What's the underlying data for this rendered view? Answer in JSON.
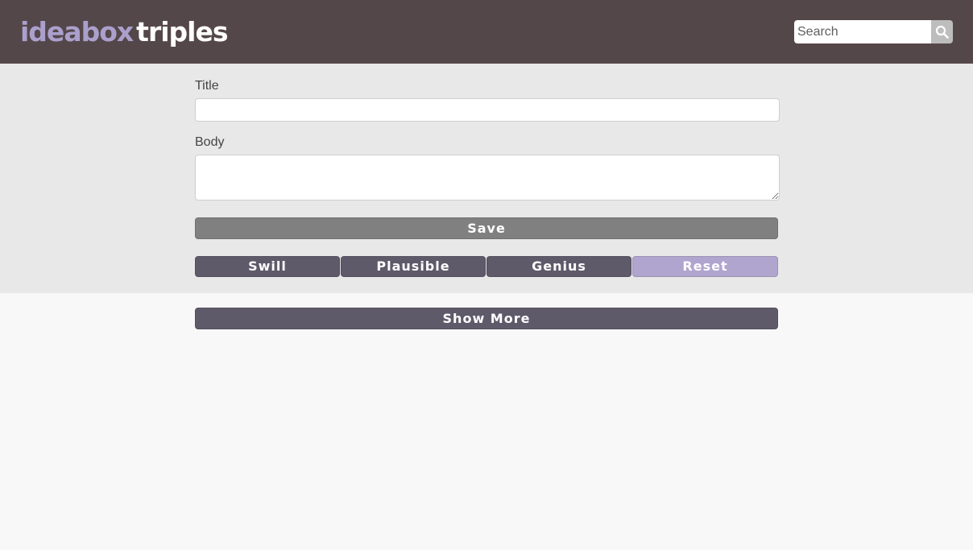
{
  "header": {
    "logo_part1": "ideabox",
    "logo_part2": "triples",
    "search_placeholder": "Search",
    "search_icon": "magnifier-icon"
  },
  "form": {
    "title_label": "Title",
    "title_value": "",
    "body_label": "Body",
    "body_value": "",
    "save_label": "Save"
  },
  "filters": {
    "swill_label": "Swill",
    "plausible_label": "Plausible",
    "genius_label": "Genius",
    "reset_label": "Reset"
  },
  "list": {
    "show_more_label": "Show More"
  },
  "colors": {
    "header_bg": "#54474a",
    "accent_purple": "#aba0cc",
    "button_dark": "#5f5a6a",
    "button_save": "#808080",
    "button_reset": "#b0a5cf",
    "form_panel_bg": "#e8e8e8",
    "page_bg": "#f8f8f8"
  }
}
